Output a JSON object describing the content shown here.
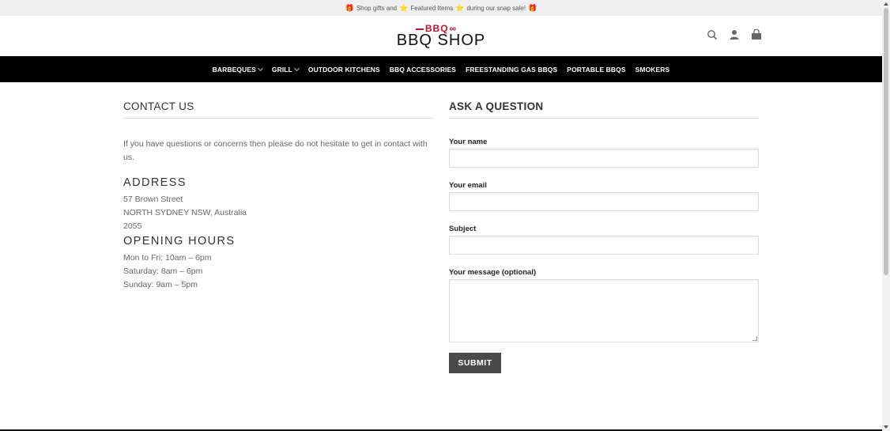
{
  "topbar": {
    "gift1": "🎁",
    "text1": "Shop gifts and",
    "star1": "⭐",
    "text2": "Featured Items",
    "star2": "⭐",
    "text3": "during our snap sale!",
    "gift2": "🎁"
  },
  "logo": {
    "mark": "BBQ",
    "word": "BBQ SHOP"
  },
  "header_icons": [
    "search-icon",
    "account-icon",
    "cart-icon"
  ],
  "nav": {
    "items": [
      {
        "label": "BARBEQUES",
        "has_dropdown": true
      },
      {
        "label": "GRILL",
        "has_dropdown": true
      },
      {
        "label": "OUTDOOR KITCHENS",
        "has_dropdown": false
      },
      {
        "label": "BBQ ACCESSORIES",
        "has_dropdown": false
      },
      {
        "label": "FREESTANDING GAS BBQS",
        "has_dropdown": false
      },
      {
        "label": "PORTABLE BBQS",
        "has_dropdown": false
      },
      {
        "label": "SMOKERS",
        "has_dropdown": false
      }
    ]
  },
  "contact": {
    "title": "CONTACT US",
    "intro": "If you have questions or concerns then please do not hesitate to get in contact with us.",
    "address_heading": "ADDRESS",
    "address_lines": [
      "57 Brown Street",
      "NORTH SYDNEY NSW, Australia",
      "2055"
    ],
    "hours_heading": "OPENING HOURS",
    "hours_lines": [
      "Mon to Fri: 10am – 6pm",
      "Saturday: 8am – 6pm",
      "Sunday: 9am – 5pm"
    ]
  },
  "form": {
    "title": "ASK A QUESTION",
    "name_label": "Your name",
    "email_label": "Your email",
    "subject_label": "Subject",
    "message_label": "Your message (optional)",
    "name_value": "",
    "email_value": "",
    "subject_value": "",
    "message_value": "",
    "submit_label": "SUBMIT"
  }
}
